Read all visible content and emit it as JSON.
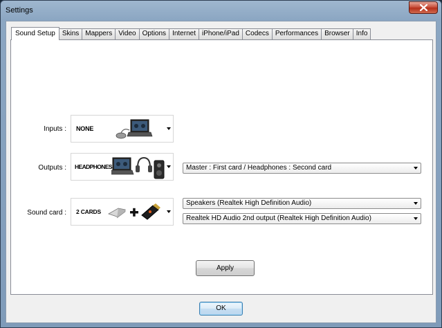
{
  "window": {
    "title": "Settings"
  },
  "tabs": [
    {
      "label": "Sound Setup",
      "active": true
    },
    {
      "label": "Skins"
    },
    {
      "label": "Mappers"
    },
    {
      "label": "Video"
    },
    {
      "label": "Options"
    },
    {
      "label": "Internet"
    },
    {
      "label": "iPhone/iPad"
    },
    {
      "label": "Codecs"
    },
    {
      "label": "Performances"
    },
    {
      "label": "Browser"
    },
    {
      "label": "Info"
    }
  ],
  "sound_setup": {
    "inputs": {
      "label": "Inputs :",
      "selected": "NONE"
    },
    "outputs": {
      "label": "Outputs :",
      "selected": "HEADPHONES",
      "routing": "Master : First card / Headphones : Second card"
    },
    "sound_card": {
      "label": "Sound card :",
      "selected": "2 CARDS",
      "first_device": "Speakers (Realtek High Definition Audio)",
      "second_device": "Realtek HD Audio 2nd output (Realtek High Definition Audio)"
    },
    "apply_label": "Apply"
  },
  "footer": {
    "ok_label": "OK"
  },
  "colors": {
    "title_bar": "#8ba6c2",
    "close_button": "#c9523d",
    "panel_bg": "#ffffff",
    "dialog_bg": "#f0f0f0"
  }
}
